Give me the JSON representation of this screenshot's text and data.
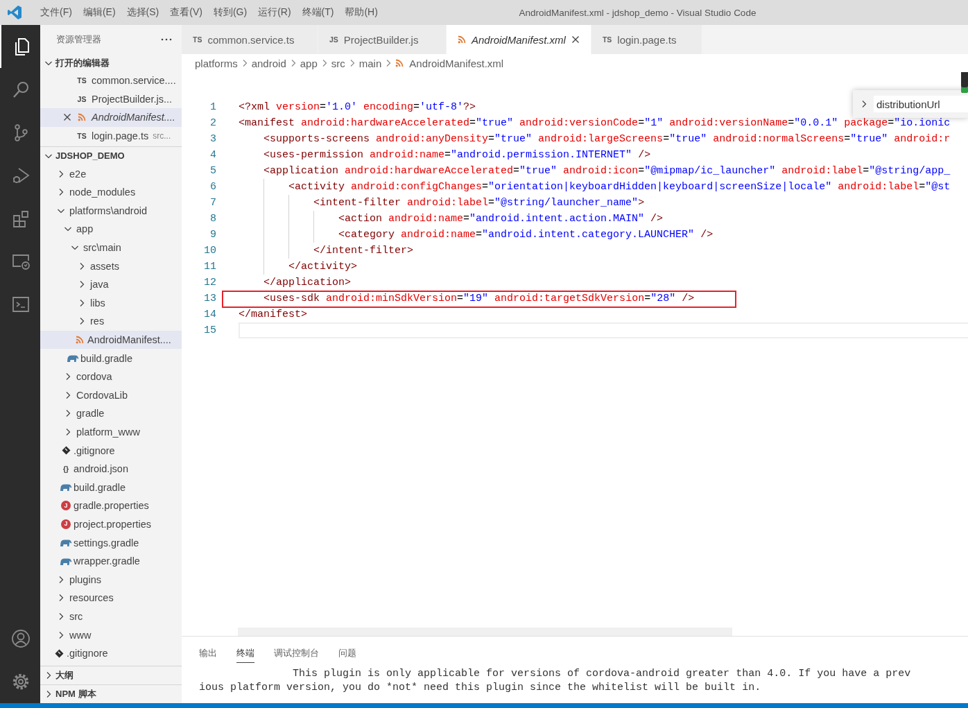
{
  "window": {
    "title": "AndroidManifest.xml - jdshop_demo - Visual Studio Code"
  },
  "menu": [
    "文件(F)",
    "编辑(E)",
    "选择(S)",
    "查看(V)",
    "转到(G)",
    "运行(R)",
    "终端(T)",
    "帮助(H)"
  ],
  "activity_bar": {
    "top": [
      {
        "kind": "explorer",
        "selected": true
      },
      {
        "kind": "search",
        "selected": false
      },
      {
        "kind": "source-control",
        "selected": false
      },
      {
        "kind": "run-debug",
        "selected": false
      },
      {
        "kind": "extensions",
        "selected": false
      },
      {
        "kind": "remote",
        "selected": false
      },
      {
        "kind": "terminal",
        "selected": false
      }
    ],
    "bottom": [
      {
        "kind": "account",
        "selected": false
      },
      {
        "kind": "settings",
        "selected": false
      }
    ]
  },
  "sidebar": {
    "title": "资源管理器",
    "open_editors": {
      "title": "打开的编辑器",
      "expanded": true,
      "items": [
        {
          "kind": "ts",
          "badge": "TS",
          "name": "common.service....",
          "italic": false,
          "selected": false
        },
        {
          "kind": "js",
          "badge": "JS",
          "name": "ProjectBuilder.js...",
          "italic": false,
          "selected": false
        },
        {
          "kind": "xml",
          "name": "AndroidManifest....",
          "italic": true,
          "selected": true
        },
        {
          "kind": "ts",
          "badge": "TS",
          "name": "login.page.ts",
          "description": "src...",
          "italic": false,
          "selected": false
        }
      ]
    },
    "project": {
      "title": "JDSHOP_DEMO",
      "expanded": true,
      "items": [
        {
          "kind": "folder",
          "name": "e2e",
          "expanded": false,
          "selected": false
        },
        {
          "kind": "folder",
          "name": "node_modules",
          "expanded": false,
          "selected": false
        },
        {
          "kind": "folder",
          "name": "platforms\\android",
          "expanded": true,
          "selected": false,
          "children": [
            {
              "kind": "folder",
              "name": "app",
              "expanded": true,
              "selected": false,
              "children": [
                {
                  "kind": "folder",
                  "name": "src\\main",
                  "expanded": true,
                  "selected": false,
                  "children": [
                    {
                      "kind": "folder",
                      "name": "assets",
                      "expanded": false,
                      "selected": false
                    },
                    {
                      "kind": "folder",
                      "name": "java",
                      "expanded": false,
                      "selected": false
                    },
                    {
                      "kind": "folder",
                      "name": "libs",
                      "expanded": false,
                      "selected": false
                    },
                    {
                      "kind": "folder",
                      "name": "res",
                      "expanded": false,
                      "selected": false
                    },
                    {
                      "kind": "xml",
                      "name": "AndroidManifest....",
                      "selected": true
                    }
                  ]
                },
                {
                  "kind": "gradle",
                  "name": "build.gradle",
                  "selected": false
                }
              ]
            },
            {
              "kind": "folder",
              "name": "cordova",
              "expanded": false,
              "selected": false
            },
            {
              "kind": "folder",
              "name": "CordovaLib",
              "expanded": false,
              "selected": false
            },
            {
              "kind": "folder",
              "name": "gradle",
              "expanded": false,
              "selected": false
            },
            {
              "kind": "folder",
              "name": "platform_www",
              "expanded": false,
              "selected": false
            },
            {
              "kind": "git",
              "name": ".gitignore",
              "selected": false
            },
            {
              "kind": "json",
              "name": "android.json",
              "badge": "{}",
              "selected": false
            },
            {
              "kind": "gradle",
              "name": "build.gradle",
              "selected": false
            },
            {
              "kind": "props",
              "name": "gradle.properties",
              "badge": "J",
              "selected": false
            },
            {
              "kind": "props",
              "name": "project.properties",
              "badge": "J",
              "selected": false
            },
            {
              "kind": "gradle",
              "name": "settings.gradle",
              "selected": false
            },
            {
              "kind": "gradle",
              "name": "wrapper.gradle",
              "selected": false
            }
          ]
        },
        {
          "kind": "folder",
          "name": "plugins",
          "expanded": false,
          "selected": false
        },
        {
          "kind": "folder",
          "name": "resources",
          "expanded": false,
          "selected": false
        },
        {
          "kind": "folder",
          "name": "src",
          "expanded": false,
          "selected": false
        },
        {
          "kind": "folder",
          "name": "www",
          "expanded": false,
          "selected": false
        },
        {
          "kind": "git",
          "name": ".gitignore",
          "selected": false
        }
      ]
    },
    "sections": [
      {
        "title": "大纲",
        "expanded": false
      },
      {
        "title": "NPM 脚本",
        "expanded": false
      }
    ]
  },
  "editor": {
    "tabs": [
      {
        "label": "common.service.ts",
        "kind": "ts",
        "badge": "TS",
        "italic": false,
        "selected": false
      },
      {
        "label": "ProjectBuilder.js",
        "kind": "js",
        "badge": "JS",
        "italic": false,
        "selected": false
      },
      {
        "label": "AndroidManifest.xml",
        "kind": "xml",
        "italic": true,
        "selected": true
      },
      {
        "label": "login.page.ts",
        "kind": "ts",
        "badge": "TS",
        "italic": false,
        "selected": false
      }
    ],
    "breadcrumbs": [
      {
        "label": "platforms"
      },
      {
        "label": "android"
      },
      {
        "label": "app"
      },
      {
        "label": "src"
      },
      {
        "label": "main"
      },
      {
        "label": "AndroidManifest.xml",
        "kind": "xml"
      }
    ],
    "find": {
      "value": "distributionUrl"
    },
    "lines": [
      {
        "number": "1",
        "highlighted": false,
        "current": false,
        "tokens": [
          {
            "kind": "tag",
            "text": "<?xml"
          },
          {
            "kind": "attr",
            "text": " version"
          },
          {
            "kind": "text",
            "text": "="
          },
          {
            "kind": "value",
            "text": "'1.0'"
          },
          {
            "kind": "attr",
            "text": " encoding"
          },
          {
            "kind": "text",
            "text": "="
          },
          {
            "kind": "value",
            "text": "'utf-8'"
          },
          {
            "kind": "tag",
            "text": "?>"
          }
        ]
      },
      {
        "number": "2",
        "highlighted": false,
        "current": false,
        "tokens": [
          {
            "kind": "tag",
            "text": "<manifest"
          },
          {
            "kind": "attr",
            "text": " android:hardwareAccelerated"
          },
          {
            "kind": "text",
            "text": "="
          },
          {
            "kind": "value",
            "text": "\"true\""
          },
          {
            "kind": "attr",
            "text": " android:versionCode"
          },
          {
            "kind": "text",
            "text": "="
          },
          {
            "kind": "value",
            "text": "\"1\""
          },
          {
            "kind": "attr",
            "text": " android:versionName"
          },
          {
            "kind": "text",
            "text": "="
          },
          {
            "kind": "value",
            "text": "\"0.0.1\""
          },
          {
            "kind": "attr",
            "text": " package"
          },
          {
            "kind": "text",
            "text": "="
          },
          {
            "kind": "value",
            "text": "\"io.ionic"
          }
        ],
        "children": [
          {
            "number": "3",
            "highlighted": false,
            "current": false,
            "tokens": [
              {
                "kind": "tag",
                "text": "<supports-screens"
              },
              {
                "kind": "attr",
                "text": " android:anyDensity"
              },
              {
                "kind": "text",
                "text": "="
              },
              {
                "kind": "value",
                "text": "\"true\""
              },
              {
                "kind": "attr",
                "text": " android:largeScreens"
              },
              {
                "kind": "text",
                "text": "="
              },
              {
                "kind": "value",
                "text": "\"true\""
              },
              {
                "kind": "attr",
                "text": " android:normalScreens"
              },
              {
                "kind": "text",
                "text": "="
              },
              {
                "kind": "value",
                "text": "\"true\""
              },
              {
                "kind": "attr",
                "text": " android:r"
              }
            ]
          },
          {
            "number": "4",
            "highlighted": false,
            "current": false,
            "tokens": [
              {
                "kind": "tag",
                "text": "<uses-permission"
              },
              {
                "kind": "attr",
                "text": " android:name"
              },
              {
                "kind": "text",
                "text": "="
              },
              {
                "kind": "value",
                "text": "\"android.permission.INTERNET\""
              },
              {
                "kind": "tag",
                "text": " />"
              }
            ]
          },
          {
            "number": "5",
            "highlighted": false,
            "current": false,
            "tokens": [
              {
                "kind": "tag",
                "text": "<application"
              },
              {
                "kind": "attr",
                "text": " android:hardwareAccelerated"
              },
              {
                "kind": "text",
                "text": "="
              },
              {
                "kind": "value",
                "text": "\"true\""
              },
              {
                "kind": "attr",
                "text": " android:icon"
              },
              {
                "kind": "text",
                "text": "="
              },
              {
                "kind": "value",
                "text": "\"@mipmap/ic_launcher\""
              },
              {
                "kind": "attr",
                "text": " android:label"
              },
              {
                "kind": "text",
                "text": "="
              },
              {
                "kind": "value",
                "text": "\"@string/app_"
              }
            ],
            "children": [
              {
                "number": "6",
                "highlighted": false,
                "current": false,
                "tokens": [
                  {
                    "kind": "tag",
                    "text": "<activity"
                  },
                  {
                    "kind": "attr",
                    "text": " android:configChanges"
                  },
                  {
                    "kind": "text",
                    "text": "="
                  },
                  {
                    "kind": "value",
                    "text": "\"orientation|keyboardHidden|keyboard|screenSize|locale\""
                  },
                  {
                    "kind": "attr",
                    "text": " android:label"
                  },
                  {
                    "kind": "text",
                    "text": "="
                  },
                  {
                    "kind": "value",
                    "text": "\"@st"
                  }
                ],
                "children": [
                  {
                    "number": "7",
                    "highlighted": false,
                    "current": false,
                    "tokens": [
                      {
                        "kind": "tag",
                        "text": "<intent-filter"
                      },
                      {
                        "kind": "attr",
                        "text": " android:label"
                      },
                      {
                        "kind": "text",
                        "text": "="
                      },
                      {
                        "kind": "value",
                        "text": "\"@string/launcher_name\""
                      },
                      {
                        "kind": "tag",
                        "text": ">"
                      }
                    ],
                    "children": [
                      {
                        "number": "8",
                        "highlighted": false,
                        "current": false,
                        "tokens": [
                          {
                            "kind": "tag",
                            "text": "<action"
                          },
                          {
                            "kind": "attr",
                            "text": " android:name"
                          },
                          {
                            "kind": "text",
                            "text": "="
                          },
                          {
                            "kind": "value",
                            "text": "\"android.intent.action.MAIN\""
                          },
                          {
                            "kind": "tag",
                            "text": " />"
                          }
                        ]
                      },
                      {
                        "number": "9",
                        "highlighted": false,
                        "current": false,
                        "tokens": [
                          {
                            "kind": "tag",
                            "text": "<category"
                          },
                          {
                            "kind": "attr",
                            "text": " android:name"
                          },
                          {
                            "kind": "text",
                            "text": "="
                          },
                          {
                            "kind": "value",
                            "text": "\"android.intent.category.LAUNCHER\""
                          },
                          {
                            "kind": "tag",
                            "text": " />"
                          }
                        ]
                      }
                    ]
                  },
                  {
                    "number": "10",
                    "highlighted": false,
                    "current": false,
                    "tokens": [
                      {
                        "kind": "tag",
                        "text": "</intent-filter>"
                      }
                    ]
                  }
                ]
              },
              {
                "number": "11",
                "highlighted": false,
                "current": false,
                "tokens": [
                  {
                    "kind": "tag",
                    "text": "</activity>"
                  }
                ]
              }
            ]
          },
          {
            "number": "12",
            "highlighted": false,
            "current": false,
            "tokens": [
              {
                "kind": "tag",
                "text": "</application>"
              }
            ]
          },
          {
            "number": "13",
            "highlighted": true,
            "current": false,
            "tokens": [
              {
                "kind": "tag",
                "text": "<uses-sdk"
              },
              {
                "kind": "attr",
                "text": " android:minSdkVersion"
              },
              {
                "kind": "text",
                "text": "="
              },
              {
                "kind": "value",
                "text": "\"19\""
              },
              {
                "kind": "attr",
                "text": " android:targetSdkVersion"
              },
              {
                "kind": "text",
                "text": "="
              },
              {
                "kind": "value",
                "text": "\"28\""
              },
              {
                "kind": "tag",
                "text": " />"
              }
            ]
          }
        ]
      },
      {
        "number": "14",
        "highlighted": false,
        "current": false,
        "tokens": [
          {
            "kind": "tag",
            "text": "</manifest>"
          }
        ]
      },
      {
        "number": "15",
        "highlighted": false,
        "current": true
      }
    ]
  },
  "panel": {
    "tabs": [
      {
        "label": "输出",
        "selected": false
      },
      {
        "label": "终端",
        "selected": true
      },
      {
        "label": "调试控制台",
        "selected": false
      },
      {
        "label": "问题",
        "selected": false
      }
    ],
    "terminal": [
      "               This plugin is only applicable for versions of cordova-android greater than 4.0. If you have a prev",
      "ious platform version, you do *not* need this plugin since the whitelist will be built in."
    ]
  }
}
